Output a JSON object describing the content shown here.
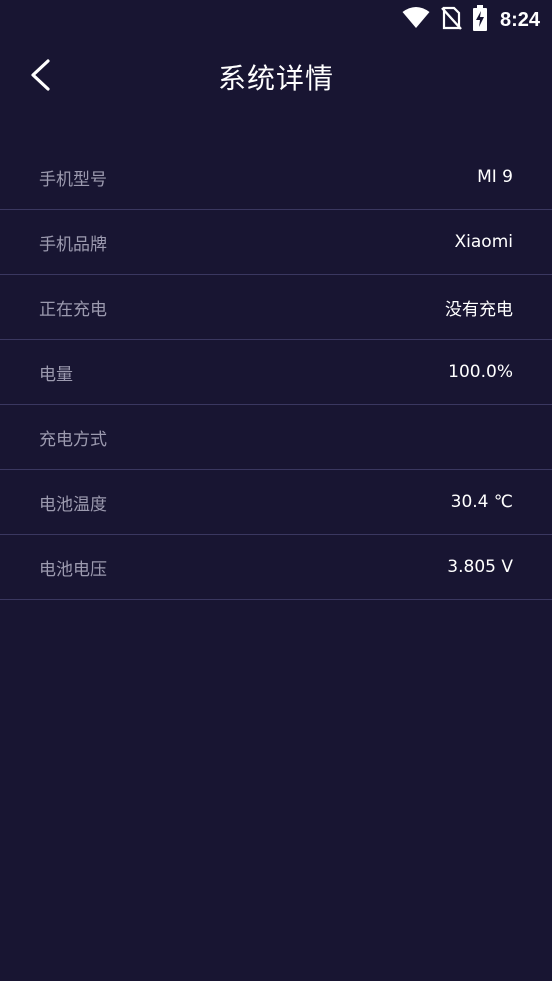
{
  "status_bar": {
    "time": "8:24",
    "icons": [
      "wifi-icon",
      "no-sim-icon",
      "battery-charging-icon"
    ]
  },
  "header": {
    "title": "系统详情",
    "back_icon": "chevron-left-icon"
  },
  "details": [
    {
      "label": "手机型号",
      "value": "MI 9"
    },
    {
      "label": "手机品牌",
      "value": "Xiaomi"
    },
    {
      "label": "正在充电",
      "value": "没有充电"
    },
    {
      "label": "电量",
      "value": "100.0%"
    },
    {
      "label": "充电方式",
      "value": ""
    },
    {
      "label": "电池温度",
      "value": "30.4 ℃"
    },
    {
      "label": "电池电压",
      "value": "3.805 V"
    }
  ],
  "colors": {
    "background": "#181532",
    "divider": "#3a3760",
    "label": "#9c9aaf",
    "value": "#ffffff"
  }
}
